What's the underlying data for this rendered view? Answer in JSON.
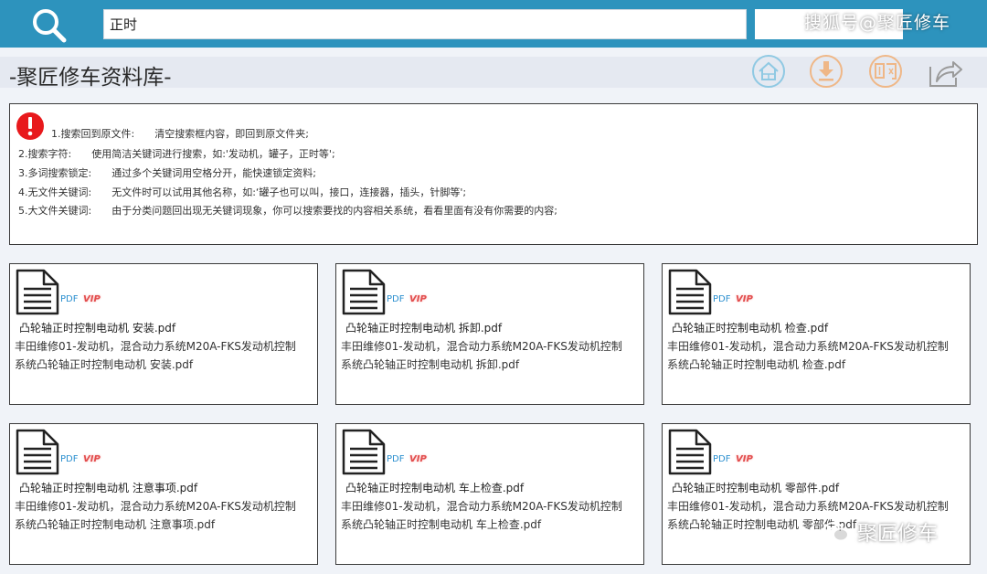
{
  "search": {
    "value": "正时",
    "icon": "search-icon"
  },
  "watermark_top": "搜狐号@聚匠修车",
  "app": {
    "title": "-聚匠修车资料库-"
  },
  "header_icons": [
    "home-icon",
    "download-icon",
    "purchase-icon",
    "share-icon"
  ],
  "tips": {
    "icon": "warning-icon",
    "lines": [
      "1.搜索回到原文件:　　清空搜索框内容，即回到原文件夹;",
      "2.搜索字符:　　使用简洁关键词进行搜索，如:'发动机，罐子，正时等';",
      "3.多词搜索锁定:　　通过多个关键词用空格分开，能快速锁定资料;",
      "4.无文件关键词:　　无文件时可以试用其他名称，如:‘罐子也可以叫，接口，连接器，插头，针脚等';",
      "5.大文件关键词:　　由于分类问题回出现无关键词现象，你可以搜索要找的内容相关系统，看看里面有没有你需要的内容;"
    ]
  },
  "files": [
    {
      "icon": "pdf-document-icon",
      "type": "PDF",
      "badge": "VIP",
      "name": "凸轮轴正时控制电动机 安装.pdf",
      "desc": "丰田维修01-发动机，混合动力系统M20A-FKS发动机控制系统凸轮轴正时控制电动机 安装.pdf"
    },
    {
      "icon": "pdf-document-icon",
      "type": "PDF",
      "badge": "VIP",
      "name": "凸轮轴正时控制电动机 拆卸.pdf",
      "desc": "丰田维修01-发动机，混合动力系统M20A-FKS发动机控制系统凸轮轴正时控制电动机 拆卸.pdf"
    },
    {
      "icon": "pdf-document-icon",
      "type": "PDF",
      "badge": "VIP",
      "name": "凸轮轴正时控制电动机 检查.pdf",
      "desc": "丰田维修01-发动机，混合动力系统M20A-FKS发动机控制系统凸轮轴正时控制电动机 检查.pdf"
    },
    {
      "icon": "pdf-document-icon",
      "type": "PDF",
      "badge": "VIP",
      "name": "凸轮轴正时控制电动机 注意事项.pdf",
      "desc": "丰田维修01-发动机，混合动力系统M20A-FKS发动机控制系统凸轮轴正时控制电动机 注意事项.pdf"
    },
    {
      "icon": "pdf-document-icon",
      "type": "PDF",
      "badge": "VIP",
      "name": "凸轮轴正时控制电动机 车上检查.pdf",
      "desc": "丰田维修01-发动机，混合动力系统M20A-FKS发动机控制系统凸轮轴正时控制电动机 车上检查.pdf"
    },
    {
      "icon": "pdf-document-icon",
      "type": "PDF",
      "badge": "VIP",
      "name": "凸轮轴正时控制电动机 零部件.pdf",
      "desc": "丰田维修01-发动机，混合动力系统M20A-FKS发动机控制系统凸轮轴正时控制电动机 零部件.pdf"
    }
  ],
  "watermark_bottom": "聚匠修车",
  "colors": {
    "topbar": "#2d93bd",
    "home": "#8fc9e3",
    "download": "#efb787",
    "purchase": "#efb787",
    "share": "#9a9a9a",
    "warning": "#e8191c",
    "pdf": "#2b8fcf",
    "vip": "#e24d4d"
  }
}
